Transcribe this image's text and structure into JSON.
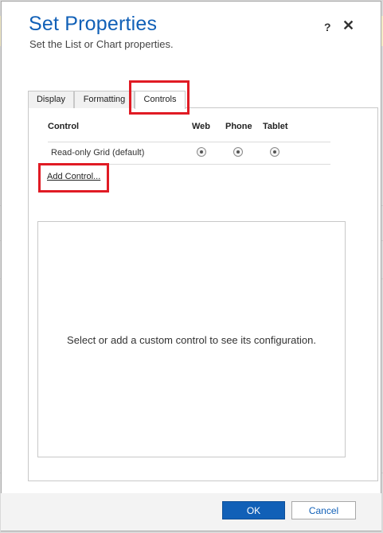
{
  "dialog": {
    "title": "Set Properties",
    "subtitle": "Set the List or Chart properties.",
    "help_glyph": "?",
    "close_glyph": "✕"
  },
  "tabs": [
    {
      "label": "Display",
      "active": false
    },
    {
      "label": "Formatting",
      "active": false
    },
    {
      "label": "Controls",
      "active": true
    }
  ],
  "controls_grid": {
    "columns": [
      "Control",
      "Web",
      "Phone",
      "Tablet"
    ],
    "rows": [
      {
        "control": "Read-only Grid (default)",
        "web": true,
        "phone": true,
        "tablet": true
      }
    ]
  },
  "add_control_label": "Add Control...",
  "config_message": "Select or add a custom control to see its configuration.",
  "footer": {
    "ok_label": "OK",
    "cancel_label": "Cancel"
  },
  "colors": {
    "accent": "#1160b7",
    "highlight": "#e01b24"
  }
}
